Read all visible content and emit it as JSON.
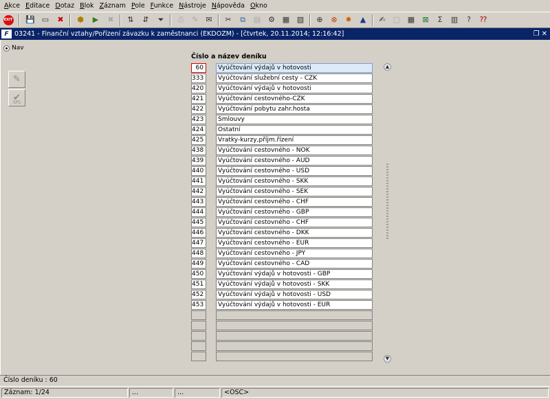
{
  "menu": [
    {
      "label": "Akce"
    },
    {
      "label": "Editace"
    },
    {
      "label": "Dotaz"
    },
    {
      "label": "Blok"
    },
    {
      "label": "Záznam"
    },
    {
      "label": "Pole"
    },
    {
      "label": "Funkce"
    },
    {
      "label": "Nástroje"
    },
    {
      "label": "Nápověda"
    },
    {
      "label": "Okno"
    }
  ],
  "toolbar": {
    "exit_label": "EXIT",
    "icons": [
      "save-icon",
      "clear-icon",
      "enter-query-icon",
      "execute-query-icon",
      "cancel-query-icon",
      "sort-icon",
      "filter-icon",
      "print-icon",
      "attach-icon",
      "mail-icon",
      "cut-icon",
      "copy-icon",
      "paste-icon",
      "edit-icon",
      "calendar-icon",
      "warning-icon",
      "report-icon",
      "export-icon",
      "excel-icon",
      "sum-icon",
      "help-icon",
      "context-help-icon"
    ]
  },
  "window": {
    "icon_label": "F",
    "title": "03241 - Finanční vztahy/Pořízení závazku k zaměstnanci (EKDOZM) - [čtvrtek, 20.11.2014; 12:16:42]",
    "restore_glyph": "❐",
    "close_glyph": "✕"
  },
  "nav": {
    "label": "Nav",
    "side_button_1_glyph": "✎",
    "side_button_2_glyph": "✔",
    "side_button_2_caption": "SPS"
  },
  "journal": {
    "column_header": "Číslo a název deníku",
    "active_index": 0,
    "rows": [
      {
        "code": "60",
        "name": "Vyúčtování výdajů v hotovosti"
      },
      {
        "code": "333",
        "name": "Vyúčtování služební cesty - CZK"
      },
      {
        "code": "420",
        "name": "Vyúčtování výdajů v hotovosti"
      },
      {
        "code": "421",
        "name": "Vyúčtování cestovného-CZK"
      },
      {
        "code": "422",
        "name": "Vyúčtování pobytu zahr.hosta"
      },
      {
        "code": "423",
        "name": "Smlouvy"
      },
      {
        "code": "424",
        "name": "Ostatní"
      },
      {
        "code": "425",
        "name": "Vratky-kurzy,příjm.řízení"
      },
      {
        "code": "438",
        "name": "Vyúčtování cestovného - NOK"
      },
      {
        "code": "439",
        "name": "Vyúčtování cestovného - AUD"
      },
      {
        "code": "440",
        "name": "Vyúčtování cestovného - USD"
      },
      {
        "code": "441",
        "name": "Vyúčtování cestovného - SKK"
      },
      {
        "code": "442",
        "name": "Vyúčtování cestovného - SEK"
      },
      {
        "code": "443",
        "name": "Vyúčtování cestovného - CHF"
      },
      {
        "code": "444",
        "name": "Vyúčtování cestovného - GBP"
      },
      {
        "code": "445",
        "name": "Vyúčtování cestovného - CHF"
      },
      {
        "code": "446",
        "name": "Vyúčtování cestovného - DKK"
      },
      {
        "code": "447",
        "name": "Vyúčtování cestovného - EUR"
      },
      {
        "code": "448",
        "name": "Vyúčtování cestovného - JPY"
      },
      {
        "code": "449",
        "name": "Vyúčtování cestovného - CAD"
      },
      {
        "code": "450",
        "name": "Vyúčtování výdajů v hotovosti - GBP"
      },
      {
        "code": "451",
        "name": "Vyúčtování výdajů v hotovosti - SKK"
      },
      {
        "code": "452",
        "name": "Vyúčtování výdajů v hotovosti - USD"
      },
      {
        "code": "453",
        "name": "Vyúčtování výdajů v hotovosti - EUR"
      },
      {
        "code": "",
        "name": ""
      },
      {
        "code": "",
        "name": ""
      },
      {
        "code": "",
        "name": ""
      },
      {
        "code": "",
        "name": ""
      },
      {
        "code": "",
        "name": ""
      }
    ]
  },
  "scrollbar": {
    "up_glyph": "▲",
    "down_glyph": "▼"
  },
  "status": {
    "message": "Číslo deníku : 60",
    "record": "Záznam: 1/24",
    "panel_2": "...",
    "panel_3": "...",
    "mode": "<OSC>"
  }
}
